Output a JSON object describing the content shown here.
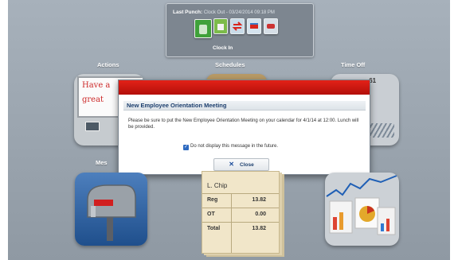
{
  "punch": {
    "label": "Last Punch:",
    "detail": "Clock Out - 03/24/2014 09:18 PM",
    "clock_in_label": "Clock In"
  },
  "tiles": {
    "actions": "Actions",
    "schedules": "Schedules",
    "time_off": "Time Off",
    "messages_partial": "Mes",
    "actions_note_line1": "Have a",
    "actions_note_line2": "great",
    "time_off_value": ".61"
  },
  "modal": {
    "title": "New Employee Orientation Meeting",
    "message": "Please be sure to put the New Employee Orientation Meeting on your calendar for 4/1/14 at 12:00.  Lunch will be provided.",
    "checkbox_label": "Do not display this message in the future.",
    "close_label": "Close"
  },
  "timecard": {
    "name": "L. Chip",
    "rows": [
      {
        "label": "Reg",
        "value": "13.82"
      },
      {
        "label": "OT",
        "value": "0.00"
      },
      {
        "label": "Total",
        "value": "13.82"
      }
    ]
  },
  "colors": {
    "modal_bar": "#d01a12",
    "title_text": "#1d3f6e",
    "background": "#9ba5af"
  }
}
